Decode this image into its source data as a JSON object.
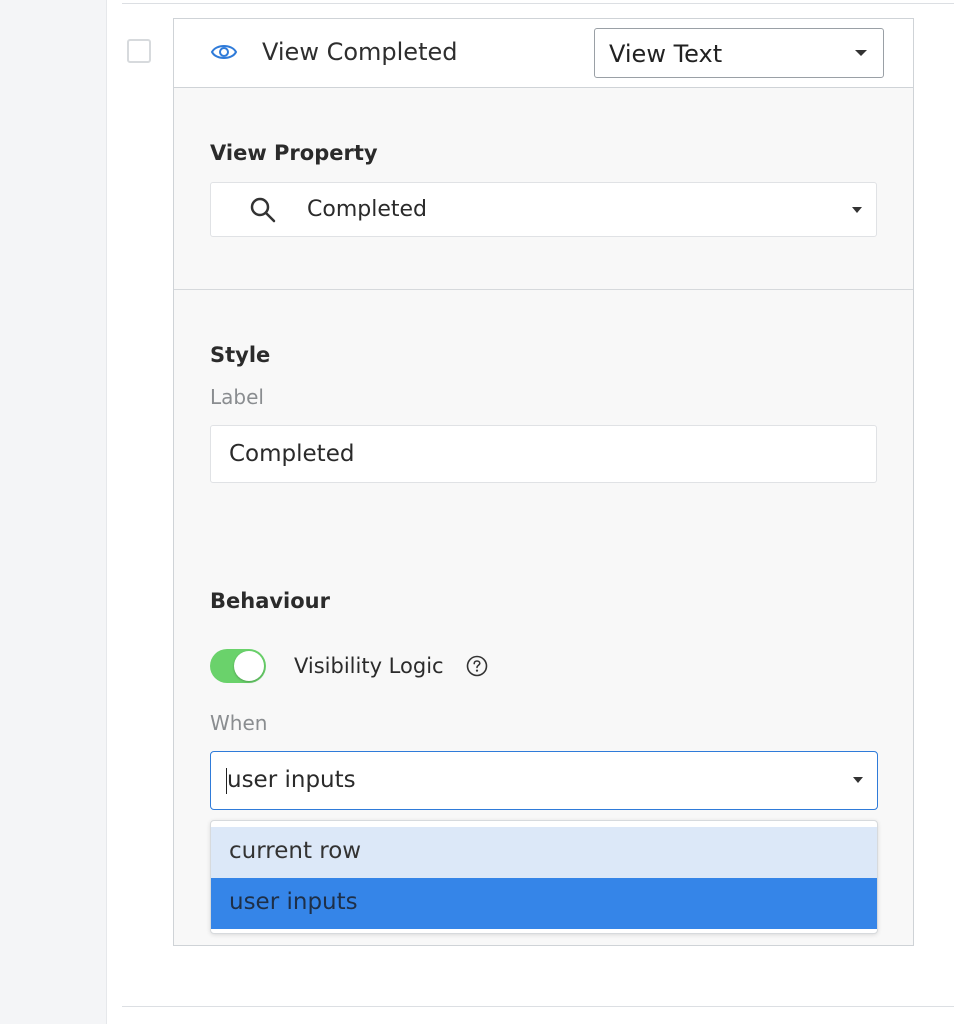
{
  "field": {
    "title": "View Completed",
    "type_select": {
      "value": "View Text"
    }
  },
  "view_property": {
    "heading": "View Property",
    "select": {
      "value": "Completed"
    }
  },
  "style": {
    "heading": "Style",
    "label_field": {
      "label": "Label",
      "value": "Completed"
    }
  },
  "behaviour": {
    "heading": "Behaviour",
    "visibility_toggle": {
      "label": "Visibility Logic",
      "on": true
    },
    "when": {
      "label": "When",
      "value": "user inputs",
      "options": [
        {
          "label": "current row",
          "state": "hover"
        },
        {
          "label": "user inputs",
          "state": "selected"
        }
      ]
    }
  },
  "colors": {
    "accent": "#3585e8",
    "focus_border": "#2f7bd9",
    "option_hover": "#dce8f8",
    "toggle_on": "#6ad26b",
    "eye_icon": "#2f7bd9"
  },
  "icons": [
    "eye-icon",
    "search-icon",
    "help-circle-icon",
    "caret-down-icon",
    "checkbox"
  ]
}
